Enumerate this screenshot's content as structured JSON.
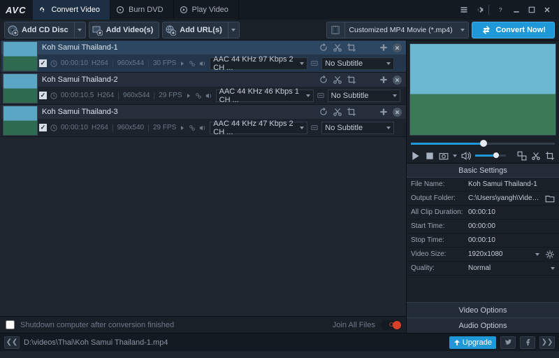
{
  "titlebar": {
    "logo": "AVC",
    "tabs": [
      {
        "label": "Convert Video",
        "active": true
      },
      {
        "label": "Burn DVD",
        "active": false
      },
      {
        "label": "Play Video",
        "active": false
      }
    ]
  },
  "toolbar": {
    "add_cd": "Add CD Disc",
    "add_videos": "Add Video(s)",
    "add_urls": "Add URL(s)",
    "profile": "Customized MP4 Movie (*.mp4)",
    "convert": "Convert Now!"
  },
  "items": [
    {
      "title": "Koh Samui Thailand-1",
      "dur": "00:00:10",
      "codec": "H264",
      "res": "960x544",
      "fps": "30 FPS",
      "audio": "AAC 44 KHz 97 Kbps 2 CH ...",
      "sub": "No Subtitle",
      "sel": true
    },
    {
      "title": "Koh Samui Thailand-2",
      "dur": "00:00:10.5",
      "codec": "H264",
      "res": "960x544",
      "fps": "29 FPS",
      "audio": "AAC 44 KHz 46 Kbps 1 CH ...",
      "sub": "No Subtitle",
      "sel": false
    },
    {
      "title": "Koh Samui Thailand-3",
      "dur": "00:00:10",
      "codec": "H264",
      "res": "960x540",
      "fps": "29 FPS",
      "audio": "AAC 44 KHz 47 Kbps 2 CH ...",
      "sub": "No Subtitle",
      "sel": false
    }
  ],
  "footer": {
    "shutdown": "Shutdown computer after conversion finished",
    "join": "Join All Files",
    "join_toggle": "OFF"
  },
  "settings": {
    "header": "Basic Settings",
    "rows": {
      "filename_l": "File Name:",
      "filename_v": "Koh Samui Thailand-1",
      "outfolder_l": "Output Folder:",
      "outfolder_v": "C:\\Users\\yangh\\Videos...",
      "clipdur_l": "All Clip Duration:",
      "clipdur_v": "00:00:10",
      "start_l": "Start Time:",
      "start_v": "00:00:00",
      "stop_l": "Stop Time:",
      "stop_v": "00:00:10",
      "vsize_l": "Video Size:",
      "vsize_v": "1920x1080",
      "quality_l": "Quality:",
      "quality_v": "Normal"
    },
    "video_opts": "Video Options",
    "audio_opts": "Audio Options"
  },
  "status": {
    "path": "D:\\videos\\Thai\\Koh Samui Thailand-1.mp4",
    "upgrade": "Upgrade"
  }
}
